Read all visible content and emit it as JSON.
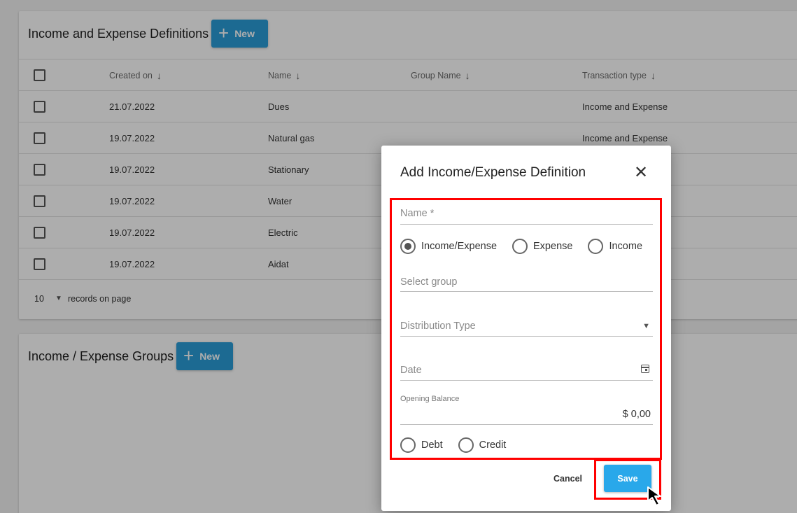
{
  "definitions_card": {
    "title": "Income and Expense Definitions",
    "new_label": "New",
    "columns": [
      "Created on",
      "Name",
      "Group Name",
      "Transaction type"
    ],
    "rows": [
      {
        "created": "21.07.2022",
        "name": "Dues",
        "group": "",
        "type": "Income and Expense"
      },
      {
        "created": "19.07.2022",
        "name": "Natural gas",
        "group": "",
        "type": "Income and Expense"
      },
      {
        "created": "19.07.2022",
        "name": "Stationary",
        "group": "",
        "type": ""
      },
      {
        "created": "19.07.2022",
        "name": "Water",
        "group": "",
        "type": ""
      },
      {
        "created": "19.07.2022",
        "name": "Electric",
        "group": "",
        "type": ""
      },
      {
        "created": "19.07.2022",
        "name": "Aidat",
        "group": "",
        "type": ""
      }
    ],
    "footer": {
      "page_size": "10",
      "records_label": "records on page"
    }
  },
  "groups_card": {
    "title": "Income / Expense Groups",
    "new_label": "New"
  },
  "modal": {
    "title": "Add Income/Expense Definition",
    "name_placeholder": "Name *",
    "type_options": [
      "Income/Expense",
      "Expense",
      "Income"
    ],
    "type_selected": "Income/Expense",
    "group_placeholder": "Select group",
    "distribution_placeholder": "Distribution Type",
    "date_placeholder": "Date",
    "opening_balance_label": "Opening Balance",
    "opening_balance_value": "$ 0,00",
    "balance_options": [
      "Debt",
      "Credit"
    ],
    "cancel_label": "Cancel",
    "save_label": "Save"
  },
  "colors": {
    "accent": "#2a9cd8",
    "save_button": "#29a8ea",
    "highlight": "#ff0000"
  },
  "icons": [
    "plus-icon",
    "sort-arrow-icon",
    "checkbox-icon",
    "close-icon",
    "dropdown-caret-icon",
    "calendar-icon",
    "mouse-cursor-icon"
  ]
}
